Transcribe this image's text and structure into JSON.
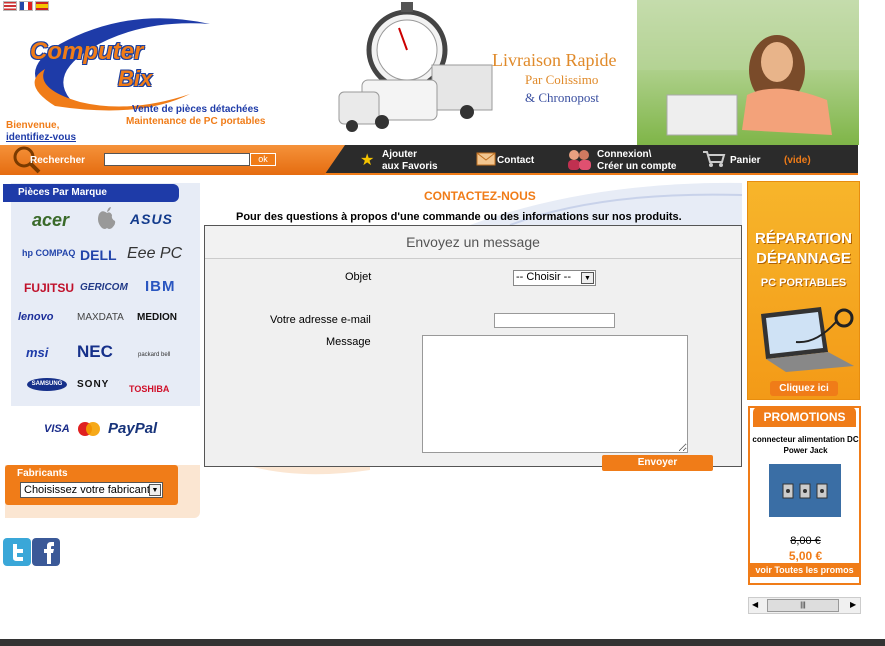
{
  "header": {
    "logo_line1": "Computer",
    "logo_line2": "Bix",
    "tagline1": "Vente de pièces détachées",
    "tagline2": "Maintenance de PC portables",
    "welcome": "Bienvenue,",
    "identify": "identifiez-vous",
    "banner_line1": "Livraison Rapide",
    "banner_line2": "Par Colissimo",
    "banner_line3": "& Chronopost"
  },
  "nav": {
    "search_label": "Rechercher",
    "search_value": "",
    "search_button": "ok",
    "favorites_line1": "Ajouter",
    "favorites_line2": "aux Favoris",
    "contact": "Contact",
    "login_line1": "Connexion\\",
    "login_line2": "Créer un compte",
    "cart": "Panier",
    "cart_status": "(vide)"
  },
  "left": {
    "brands_title": "Pièces Par Marque",
    "brands": [
      "acer",
      "ASUS",
      "hp COMPAQ",
      "DELL",
      "Eee PC",
      "FUJITSU",
      "GERICOM",
      "IBM",
      "lenovo",
      "MAXDATA",
      "MEDION",
      "msi",
      "NEC",
      "packard bell",
      "SAMSUNG",
      "SONY",
      "TOSHIBA"
    ],
    "payment": [
      "VISA",
      "MasterCard",
      "PayPal"
    ],
    "manufacturer_title": "Fabricants",
    "manufacturer_select": "Choisissez votre fabricant"
  },
  "main": {
    "title": "CONTACTEZ-NOUS",
    "description": "Pour des questions à propos d'une commande ou des informations sur nos produits.",
    "form_title": "Envoyez un message",
    "subject_label": "Objet",
    "subject_value": "-- Choisir --",
    "email_label": "Votre adresse e-mail",
    "email_value": "",
    "message_label": "Message",
    "message_value": "",
    "send_button": "Envoyer"
  },
  "right": {
    "repair_line1": "RÉPARATION",
    "repair_line2": "DÉPANNAGE",
    "repair_line3": "PC PORTABLES",
    "repair_cta": "Cliquez ici",
    "promo_title": "PROMOTIONS",
    "promo_product": "connecteur alimentation DC Power Jack",
    "promo_old_price": "8,00 €",
    "promo_new_price": "5,00 €",
    "promo_all": "voir Toutes les promos"
  },
  "colors": {
    "orange": "#f07c18",
    "blue": "#1e3ba8",
    "dark": "#2b2b2b"
  }
}
